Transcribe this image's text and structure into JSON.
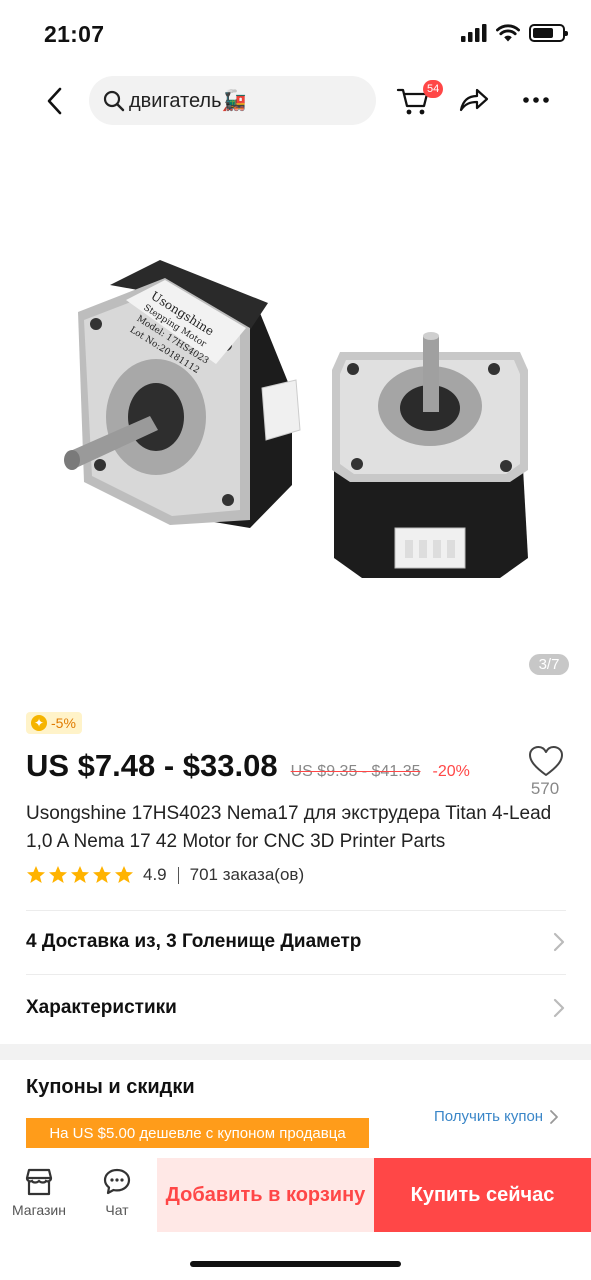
{
  "status_bar": {
    "time": "21:07"
  },
  "header": {
    "search_text": "двигатель🚂",
    "cart_count": "54"
  },
  "gallery": {
    "counter": "3/7",
    "label_lines": [
      "Usongshine",
      "Stepping Motor",
      "Model: 17HS4023",
      "Lot No:20181112"
    ]
  },
  "price": {
    "discount_badge": "-5%",
    "range": "US $7.48 - $33.08",
    "old_range": "US $9.35 - $41.35",
    "off": "-20%"
  },
  "wishlist": {
    "count": "570"
  },
  "product": {
    "title": "Usongshine 17HS4023 Nema17 для экструдера Titan 4-Lead 1,0 A Nema 17 42 Motor for CNC 3D Printer Parts",
    "rating": "4.9",
    "orders": "701 заказа(ов)",
    "stars": 5
  },
  "rows": {
    "options": "4 Доставка из, 3 Голенище Диаметр",
    "specs": "Характеристики"
  },
  "coupons": {
    "title": "Купоны и скидки",
    "get_coupon": "Получить купон",
    "banner": "На US $5.00 дешевле с купоном продавца"
  },
  "bottom_bar": {
    "store": "Магазин",
    "chat": "Чат",
    "add_to_cart": "Добавить в корзину",
    "buy_now": "Купить сейчас"
  },
  "colors": {
    "accent": "#ff4747",
    "coupon": "#ff9c1a",
    "star": "#ffb300",
    "link": "#3a86c8"
  }
}
